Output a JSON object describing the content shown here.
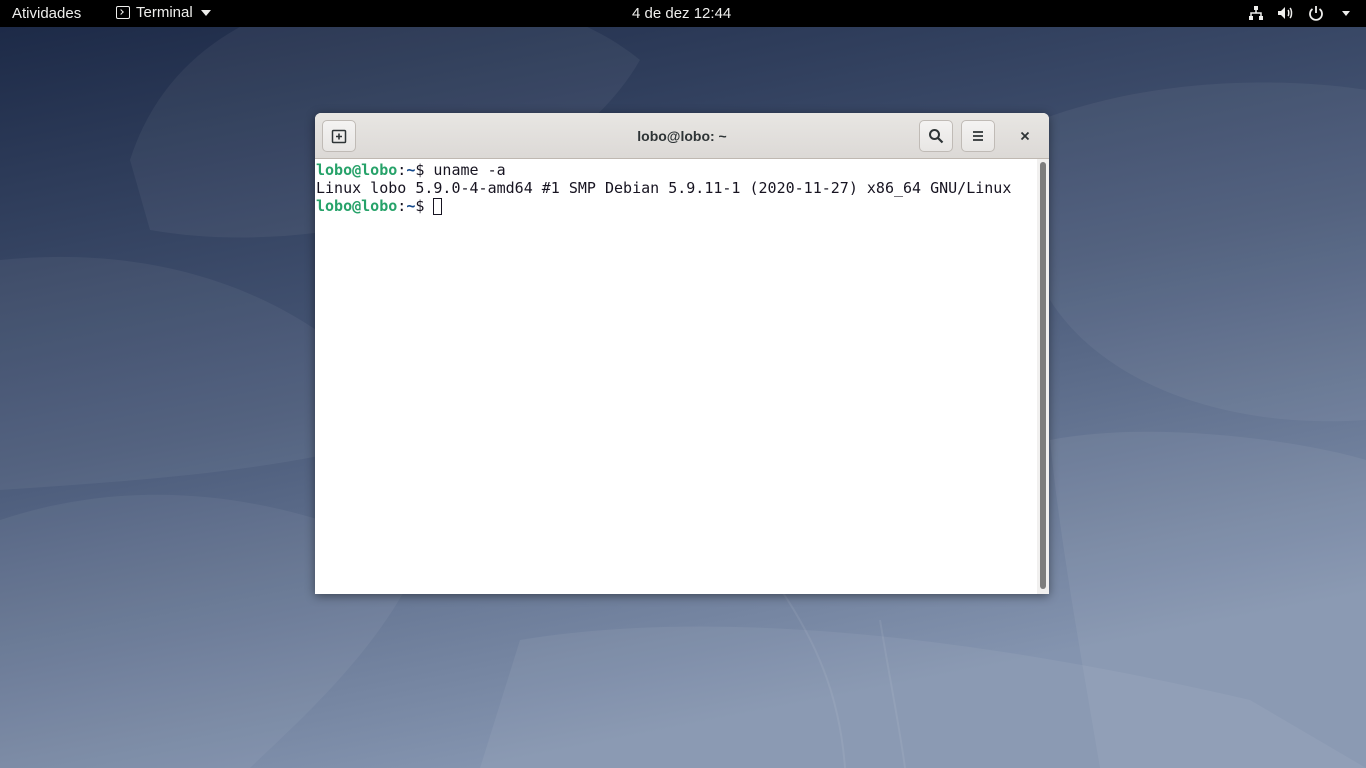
{
  "topbar": {
    "activities_label": "Atividades",
    "app_menu_label": "Terminal",
    "clock": "4 de dez  12:44",
    "icons": [
      "network-icon",
      "volume-icon",
      "power-icon",
      "chevron-down-icon"
    ]
  },
  "window": {
    "title": "lobo@lobo: ~",
    "buttons": [
      "new-tab-icon",
      "search-icon",
      "hamburger-menu-icon",
      "close-icon"
    ]
  },
  "terminal": {
    "lines": [
      {
        "user": "lobo@lobo",
        "sep": ":",
        "path": "~",
        "symbol": "$",
        "command": " uname -a"
      },
      {
        "output": "Linux lobo 5.9.0-4-amd64 #1 SMP Debian 5.9.11-1 (2020-11-27) x86_64 GNU/Linux"
      },
      {
        "user": "lobo@lobo",
        "sep": ":",
        "path": "~",
        "symbol": "$",
        "command": " "
      }
    ]
  },
  "colors": {
    "prompt_user": "#26a269",
    "prompt_path": "#12488b",
    "topbar_bg": "#000000",
    "wallpaper_dark": "#1b2a45",
    "wallpaper_light": "#7e8ca8"
  }
}
